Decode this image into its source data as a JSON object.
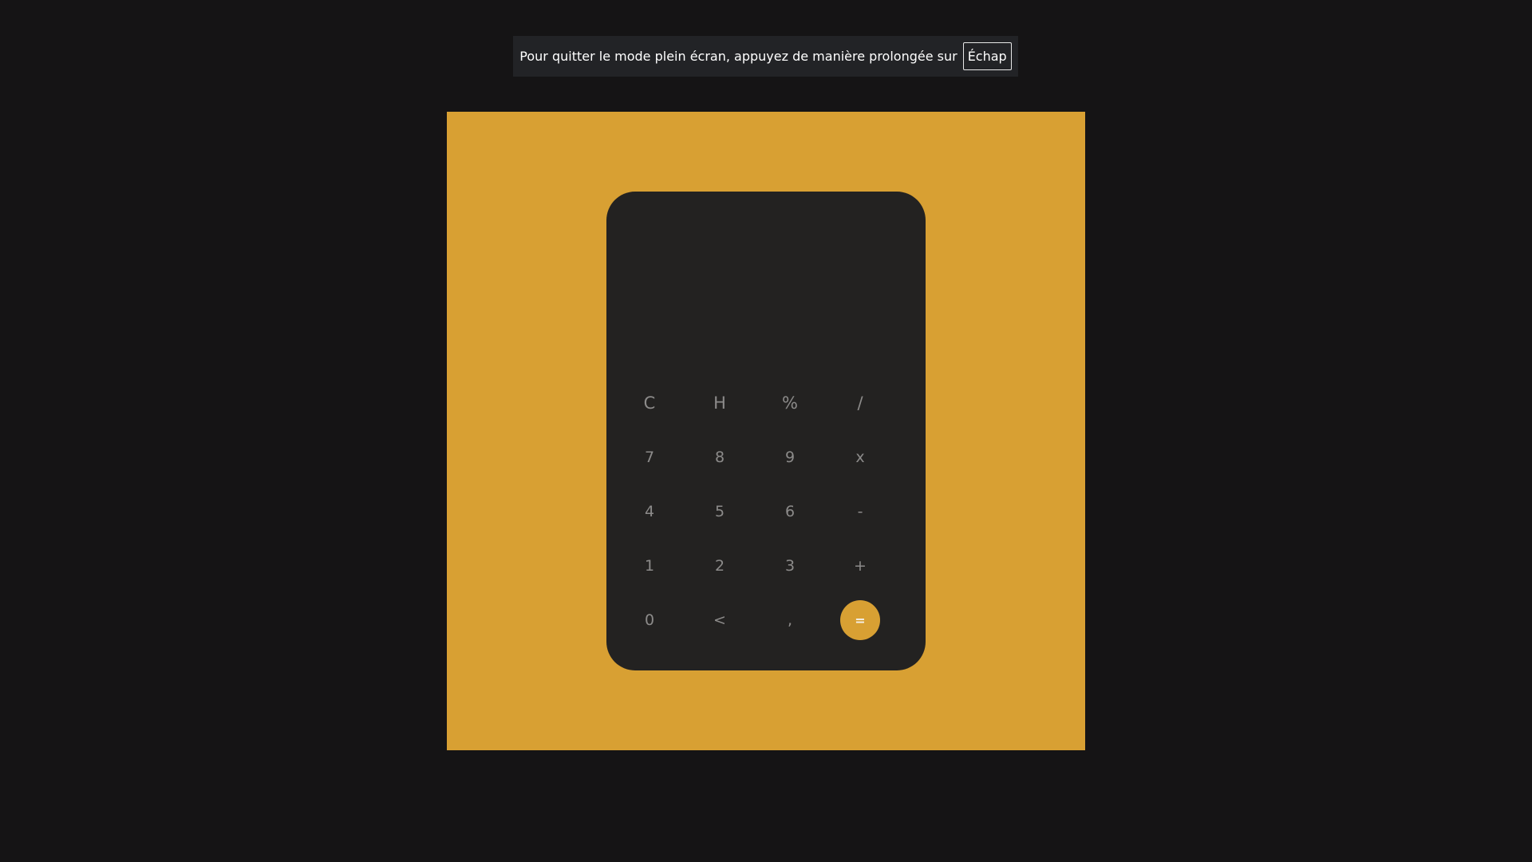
{
  "fullscreen_notice": {
    "message": "Pour quitter le mode plein écran, appuyez de manière prolongée sur",
    "key": "Échap"
  },
  "calculator": {
    "display": "",
    "keys": {
      "clear": "C",
      "history": "H",
      "percent": "%",
      "divide": "/",
      "seven": "7",
      "eight": "8",
      "nine": "9",
      "multiply": "x",
      "four": "4",
      "five": "5",
      "six": "6",
      "subtract": "-",
      "one": "1",
      "two": "2",
      "three": "3",
      "add": "+",
      "zero": "0",
      "backspace": "<",
      "decimal": ",",
      "equals": "="
    }
  },
  "colors": {
    "page_background": "#151415",
    "accent": "#d8a033",
    "calculator_body": "#232221",
    "key_text": "#8c8b8a"
  }
}
